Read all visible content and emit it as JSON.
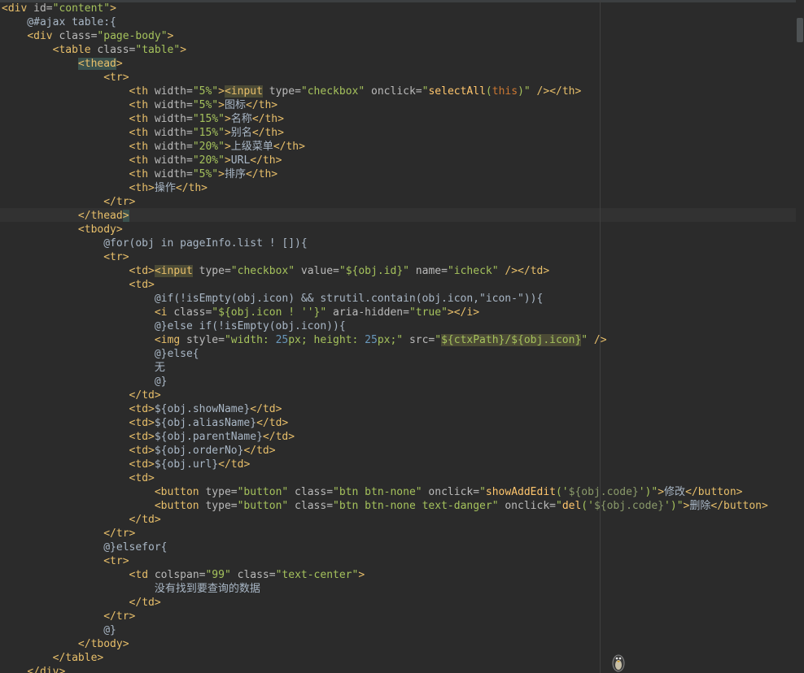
{
  "editor": {
    "lines": [
      [
        [
          "tag",
          "<div "
        ],
        [
          "attr",
          "id="
        ],
        [
          "val",
          "\"content\""
        ],
        [
          "tag",
          ">"
        ]
      ],
      [
        [
          "txt",
          "    @#ajax table:{"
        ]
      ],
      [
        [
          "txt",
          "    "
        ],
        [
          "tag",
          "<div "
        ],
        [
          "attr",
          "class="
        ],
        [
          "val",
          "\"page-body\""
        ],
        [
          "tag",
          ">"
        ]
      ],
      [
        [
          "txt",
          "        "
        ],
        [
          "tag",
          "<table "
        ],
        [
          "attr",
          "class="
        ],
        [
          "val",
          "\"table\""
        ],
        [
          "tag",
          ">"
        ]
      ],
      [
        [
          "txt",
          "            "
        ],
        [
          "taghl",
          "<thead"
        ],
        [
          "tag",
          ">"
        ]
      ],
      [
        [
          "txt",
          "                "
        ],
        [
          "tag",
          "<tr>"
        ]
      ],
      [
        [
          "txt",
          "                    "
        ],
        [
          "tag",
          "<th "
        ],
        [
          "attr",
          "width="
        ],
        [
          "val",
          "\"5%\""
        ],
        [
          "tag",
          ">"
        ],
        [
          "taghl2",
          "<input"
        ],
        [
          "attr",
          " type="
        ],
        [
          "val",
          "\"checkbox\""
        ],
        [
          "attr",
          " onclick="
        ],
        [
          "val",
          "\""
        ],
        [
          "fn",
          "selectAll"
        ],
        [
          "val",
          "("
        ],
        [
          "kw",
          "this"
        ],
        [
          "val",
          ")\""
        ],
        [
          "tag",
          " /></th>"
        ]
      ],
      [
        [
          "txt",
          "                    "
        ],
        [
          "tag",
          "<th "
        ],
        [
          "attr",
          "width="
        ],
        [
          "val",
          "\"5%\""
        ],
        [
          "tag",
          ">"
        ],
        [
          "txt",
          "图标"
        ],
        [
          "tag",
          "</th>"
        ]
      ],
      [
        [
          "txt",
          "                    "
        ],
        [
          "tag",
          "<th "
        ],
        [
          "attr",
          "width="
        ],
        [
          "val",
          "\"15%\""
        ],
        [
          "tag",
          ">"
        ],
        [
          "txt",
          "名称"
        ],
        [
          "tag",
          "</th>"
        ]
      ],
      [
        [
          "txt",
          "                    "
        ],
        [
          "tag",
          "<th "
        ],
        [
          "attr",
          "width="
        ],
        [
          "val",
          "\"15%\""
        ],
        [
          "tag",
          ">"
        ],
        [
          "txt",
          "别名"
        ],
        [
          "tag",
          "</th>"
        ]
      ],
      [
        [
          "txt",
          "                    "
        ],
        [
          "tag",
          "<th "
        ],
        [
          "attr",
          "width="
        ],
        [
          "val",
          "\"20%\""
        ],
        [
          "tag",
          ">"
        ],
        [
          "txt",
          "上级菜单"
        ],
        [
          "tag",
          "</th>"
        ]
      ],
      [
        [
          "txt",
          "                    "
        ],
        [
          "tag",
          "<th "
        ],
        [
          "attr",
          "width="
        ],
        [
          "val",
          "\"20%\""
        ],
        [
          "tag",
          ">"
        ],
        [
          "txt",
          "URL"
        ],
        [
          "tag",
          "</th>"
        ]
      ],
      [
        [
          "txt",
          "                    "
        ],
        [
          "tag",
          "<th "
        ],
        [
          "attr",
          "width="
        ],
        [
          "val",
          "\"5%\""
        ],
        [
          "tag",
          ">"
        ],
        [
          "txt",
          "排序"
        ],
        [
          "tag",
          "</th>"
        ]
      ],
      [
        [
          "txt",
          "                    "
        ],
        [
          "tag",
          "<th>"
        ],
        [
          "txt",
          "操作"
        ],
        [
          "tag",
          "</th>"
        ]
      ],
      [
        [
          "txt",
          "                "
        ],
        [
          "tag",
          "</tr>"
        ]
      ],
      [
        [
          "txt",
          "            "
        ],
        [
          "tag",
          "</thead"
        ],
        [
          "taghl",
          ">"
        ]
      ],
      [
        [
          "txt",
          "            "
        ],
        [
          "tag",
          "<tbody>"
        ]
      ],
      [
        [
          "txt",
          "                @for(obj in pageInfo.list ! []){"
        ]
      ],
      [
        [
          "txt",
          "                "
        ],
        [
          "tag",
          "<tr>"
        ]
      ],
      [
        [
          "txt",
          "                    "
        ],
        [
          "tag",
          "<td>"
        ],
        [
          "taghl2",
          "<input"
        ],
        [
          "attr",
          " type="
        ],
        [
          "val",
          "\"checkbox\""
        ],
        [
          "attr",
          " value="
        ],
        [
          "val",
          "\"${obj.id}\""
        ],
        [
          "attr",
          " name="
        ],
        [
          "val",
          "\"icheck\""
        ],
        [
          "tag",
          " /></td>"
        ]
      ],
      [
        [
          "txt",
          "                    "
        ],
        [
          "tag",
          "<td>"
        ]
      ],
      [
        [
          "txt",
          "                        @if(!isEmpty(obj.icon) && strutil.contain(obj.icon,\"icon-\")){"
        ]
      ],
      [
        [
          "txt",
          "                        "
        ],
        [
          "tag",
          "<i "
        ],
        [
          "attr",
          "class="
        ],
        [
          "val",
          "\"${obj.icon ! ''}\""
        ],
        [
          "attr",
          " aria-hidden="
        ],
        [
          "val",
          "\"true\""
        ],
        [
          "tag",
          "></i>"
        ]
      ],
      [
        [
          "txt",
          "                        @}else if(!isEmpty(obj.icon)){"
        ]
      ],
      [
        [
          "txt",
          "                        "
        ],
        [
          "tag",
          "<img "
        ],
        [
          "attr",
          "style="
        ],
        [
          "val",
          "\"width: "
        ],
        [
          "num",
          "25"
        ],
        [
          "val",
          "px; height: "
        ],
        [
          "num",
          "25"
        ],
        [
          "val",
          "px;\""
        ],
        [
          "attr",
          " src="
        ],
        [
          "val",
          "\""
        ],
        [
          "valhl",
          "${ctxPath}/${obj.icon}"
        ],
        [
          "val",
          "\""
        ],
        [
          "tag",
          " />"
        ]
      ],
      [
        [
          "txt",
          "                        @}else{"
        ]
      ],
      [
        [
          "txt",
          "                        无"
        ]
      ],
      [
        [
          "txt",
          "                        @}"
        ]
      ],
      [
        [
          "txt",
          "                    "
        ],
        [
          "tag",
          "</td>"
        ]
      ],
      [
        [
          "txt",
          "                    "
        ],
        [
          "tag",
          "<td>"
        ],
        [
          "txt",
          "${obj.showName}"
        ],
        [
          "tag",
          "</td>"
        ]
      ],
      [
        [
          "txt",
          "                    "
        ],
        [
          "tag",
          "<td>"
        ],
        [
          "txt",
          "${obj.aliasName}"
        ],
        [
          "tag",
          "</td>"
        ]
      ],
      [
        [
          "txt",
          "                    "
        ],
        [
          "tag",
          "<td>"
        ],
        [
          "txt",
          "${obj.parentName}"
        ],
        [
          "tag",
          "</td>"
        ]
      ],
      [
        [
          "txt",
          "                    "
        ],
        [
          "tag",
          "<td>"
        ],
        [
          "txt",
          "${obj.orderNo}"
        ],
        [
          "tag",
          "</td>"
        ]
      ],
      [
        [
          "txt",
          "                    "
        ],
        [
          "tag",
          "<td>"
        ],
        [
          "txt",
          "${obj.url}"
        ],
        [
          "tag",
          "</td>"
        ]
      ],
      [
        [
          "txt",
          "                    "
        ],
        [
          "tag",
          "<td>"
        ]
      ],
      [
        [
          "txt",
          "                        "
        ],
        [
          "tag",
          "<button "
        ],
        [
          "attr",
          "type="
        ],
        [
          "val",
          "\"button\""
        ],
        [
          "attr",
          " class="
        ],
        [
          "val",
          "\"btn btn-none\""
        ],
        [
          "attr",
          " onclick="
        ],
        [
          "val",
          "\""
        ],
        [
          "fn",
          "showAddEdit"
        ],
        [
          "val",
          "('"
        ],
        [
          "valdim",
          "${obj.code}"
        ],
        [
          "val",
          "')\""
        ],
        [
          "tag",
          ">"
        ],
        [
          "txt",
          "修改"
        ],
        [
          "tag",
          "</button>"
        ]
      ],
      [
        [
          "txt",
          "                        "
        ],
        [
          "tag",
          "<button "
        ],
        [
          "attr",
          "type="
        ],
        [
          "val",
          "\"button\""
        ],
        [
          "attr",
          " class="
        ],
        [
          "val",
          "\"btn btn-none text-danger\""
        ],
        [
          "attr",
          " onclick="
        ],
        [
          "val",
          "\""
        ],
        [
          "fn",
          "del"
        ],
        [
          "val",
          "('"
        ],
        [
          "valdim",
          "${obj.code}"
        ],
        [
          "val",
          "')\""
        ],
        [
          "tag",
          ">"
        ],
        [
          "txt",
          "删除"
        ],
        [
          "tag",
          "</button>"
        ]
      ],
      [
        [
          "txt",
          "                    "
        ],
        [
          "tag",
          "</td>"
        ]
      ],
      [
        [
          "txt",
          "                "
        ],
        [
          "tag",
          "</tr>"
        ]
      ],
      [
        [
          "txt",
          "                @}elsefor{"
        ]
      ],
      [
        [
          "txt",
          "                "
        ],
        [
          "tag",
          "<tr>"
        ]
      ],
      [
        [
          "txt",
          "                    "
        ],
        [
          "tag",
          "<td "
        ],
        [
          "attr",
          "colspan="
        ],
        [
          "val",
          "\"99\""
        ],
        [
          "attr",
          " class="
        ],
        [
          "val",
          "\"text-center\""
        ],
        [
          "tag",
          ">"
        ]
      ],
      [
        [
          "txt",
          "                        没有找到要查询的数据"
        ]
      ],
      [
        [
          "txt",
          "                    "
        ],
        [
          "tag",
          "</td>"
        ]
      ],
      [
        [
          "txt",
          "                "
        ],
        [
          "tag",
          "</tr>"
        ]
      ],
      [
        [
          "txt",
          "                @}"
        ]
      ],
      [
        [
          "txt",
          "            "
        ],
        [
          "tag",
          "</tbody>"
        ]
      ],
      [
        [
          "txt",
          "        "
        ],
        [
          "tag",
          "</table>"
        ]
      ],
      [
        [
          "txt",
          "    "
        ],
        [
          "tag",
          "</div>"
        ]
      ]
    ]
  },
  "colors": {
    "background": "#2b2b2b",
    "tag": "#e8bf6a",
    "attribute": "#bababa",
    "string": "#a5c25c",
    "text": "#a9b7c6",
    "keyword": "#cc7832",
    "function": "#ffc66d"
  },
  "icons": {
    "mascot": "penguin-mascot-icon"
  }
}
